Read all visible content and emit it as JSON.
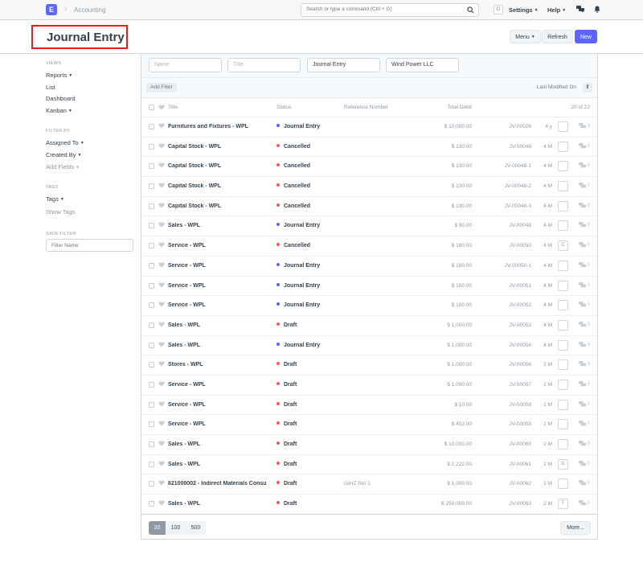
{
  "navbar": {
    "logo_letter": "E",
    "breadcrumb": "Accounting",
    "search_placeholder": "Search or type a command (Ctrl + G)",
    "avatar_letter": "D",
    "settings_label": "Settings",
    "help_label": "Help"
  },
  "page": {
    "title": "Journal Entry",
    "menu_label": "Menu",
    "refresh_label": "Refresh",
    "new_label": "New"
  },
  "sidebar": {
    "views_heading": "VIEWS",
    "reports_label": "Reports",
    "list_label": "List",
    "dashboard_label": "Dashboard",
    "kanban_label": "Kanban",
    "filter_by_heading": "FILTER BY",
    "assigned_to_label": "Assigned To",
    "created_by_label": "Created By",
    "add_fields_label": "Add Fields",
    "tags_heading": "TAGS",
    "tags_label": "Tags",
    "show_tags_label": "Show Tags",
    "save_filter_heading": "SAVE FILTER",
    "filter_name_placeholder": "Filter Name"
  },
  "filters": {
    "name_placeholder": "Name",
    "title_placeholder": "Title",
    "doctype_value": "Journal Entry",
    "company_value": "Wind Power LLC"
  },
  "toolbar": {
    "add_filter_label": "Add Filter",
    "sort_label": "Last Modified On"
  },
  "list_header": {
    "title": "Title",
    "status": "Status",
    "reference": "Reference Number",
    "debit": "Total Debit",
    "count": "20 of 22"
  },
  "colors": {
    "accent": "#5e64ff",
    "status_journal_entry": "#5e64ff",
    "status_cancelled": "#ff5858",
    "status_draft": "#ff5858"
  },
  "rows": [
    {
      "title": "Furnitures and Fixtures - WPL",
      "status": "Journal Entry",
      "ref": "",
      "debit": "$ 10,000.00",
      "jv": "JV-00026",
      "ago": "4 y",
      "avatar": "",
      "comments": "0"
    },
    {
      "title": "Capital Stock - WPL",
      "status": "Cancelled",
      "ref": "",
      "debit": "$ 130.00",
      "jv": "JV-00048",
      "ago": "4 M",
      "avatar": "",
      "comments": "0"
    },
    {
      "title": "Capital Stock - WPL",
      "status": "Cancelled",
      "ref": "",
      "debit": "$ 130.00",
      "jv": "JV-00048-1",
      "ago": "4 M",
      "avatar": "",
      "comments": "0"
    },
    {
      "title": "Capital Stock - WPL",
      "status": "Cancelled",
      "ref": "",
      "debit": "$ 130.00",
      "jv": "JV-00048-2",
      "ago": "4 M",
      "avatar": "",
      "comments": "0"
    },
    {
      "title": "Capital Stock - WPL",
      "status": "Cancelled",
      "ref": "",
      "debit": "$ 130.00",
      "jv": "JV-00048-3",
      "ago": "4 M",
      "avatar": "",
      "comments": "0"
    },
    {
      "title": "Sales - WPL",
      "status": "Journal Entry",
      "ref": "",
      "debit": "$ 90.00",
      "jv": "JV-00049",
      "ago": "4 M",
      "avatar": "",
      "comments": "0"
    },
    {
      "title": "Service - WPL",
      "status": "Cancelled",
      "ref": "",
      "debit": "$ 180.00",
      "jv": "JV-00050",
      "ago": "4 M",
      "avatar": "C",
      "comments": "0"
    },
    {
      "title": "Service - WPL",
      "status": "Journal Entry",
      "ref": "",
      "debit": "$ 180.00",
      "jv": "JV-00050-1",
      "ago": "4 M",
      "avatar": "",
      "comments": "0"
    },
    {
      "title": "Service - WPL",
      "status": "Journal Entry",
      "ref": "",
      "debit": "$ 150.00",
      "jv": "JV-00051",
      "ago": "4 M",
      "avatar": "",
      "comments": "0"
    },
    {
      "title": "Service - WPL",
      "status": "Journal Entry",
      "ref": "",
      "debit": "$ 180.00",
      "jv": "JV-00052",
      "ago": "4 M",
      "avatar": "",
      "comments": "0"
    },
    {
      "title": "Sales - WPL",
      "status": "Draft",
      "ref": "",
      "debit": "$ 1,000.00",
      "jv": "JV-00053",
      "ago": "4 M",
      "avatar": "",
      "comments": "0"
    },
    {
      "title": "Sales - WPL",
      "status": "Journal Entry",
      "ref": "",
      "debit": "$ 1,000.00",
      "jv": "JV-00054",
      "ago": "4 M",
      "avatar": "",
      "comments": "0"
    },
    {
      "title": "Stores - WPL",
      "status": "Draft",
      "ref": "",
      "debit": "$ 1,000.00",
      "jv": "JV-00056",
      "ago": "2 M",
      "avatar": "",
      "comments": "0"
    },
    {
      "title": "Service - WPL",
      "status": "Draft",
      "ref": "",
      "debit": "$ 1,000.00",
      "jv": "JV-00057",
      "ago": "2 M",
      "avatar": "",
      "comments": "0"
    },
    {
      "title": "Service - WPL",
      "status": "Draft",
      "ref": "",
      "debit": "$ 10.00",
      "jv": "JV-00058",
      "ago": "2 M",
      "avatar": "",
      "comments": "0"
    },
    {
      "title": "Service - WPL",
      "status": "Draft",
      "ref": "",
      "debit": "$ 453.00",
      "jv": "JV-00059",
      "ago": "2 M",
      "avatar": "",
      "comments": "0"
    },
    {
      "title": "Sales - WPL",
      "status": "Draft",
      "ref": "",
      "debit": "$ 10,000.00",
      "jv": "JV-00060",
      "ago": "2 M",
      "avatar": "",
      "comments": "0"
    },
    {
      "title": "Sales - WPL",
      "status": "Draft",
      "ref": "",
      "debit": "$ 2,222.00",
      "jv": "JV-00061",
      "ago": "2 M",
      "avatar": "G",
      "comments": "0"
    },
    {
      "title": "621000002 - Indirect Materials Consu",
      "status": "Draft",
      "ref": "GIHZ Ref 1",
      "debit": "$ 5,000.00",
      "jv": "JV-00062",
      "ago": "2 M",
      "avatar": "",
      "comments": "0"
    },
    {
      "title": "Sales - WPL",
      "status": "Draft",
      "ref": "",
      "debit": "$ 250,000.00",
      "jv": "JV-00063",
      "ago": "2 M",
      "avatar": "T",
      "comments": "0"
    }
  ],
  "pagination": {
    "sizes": [
      "20",
      "100",
      "500"
    ],
    "more_label": "More..."
  }
}
